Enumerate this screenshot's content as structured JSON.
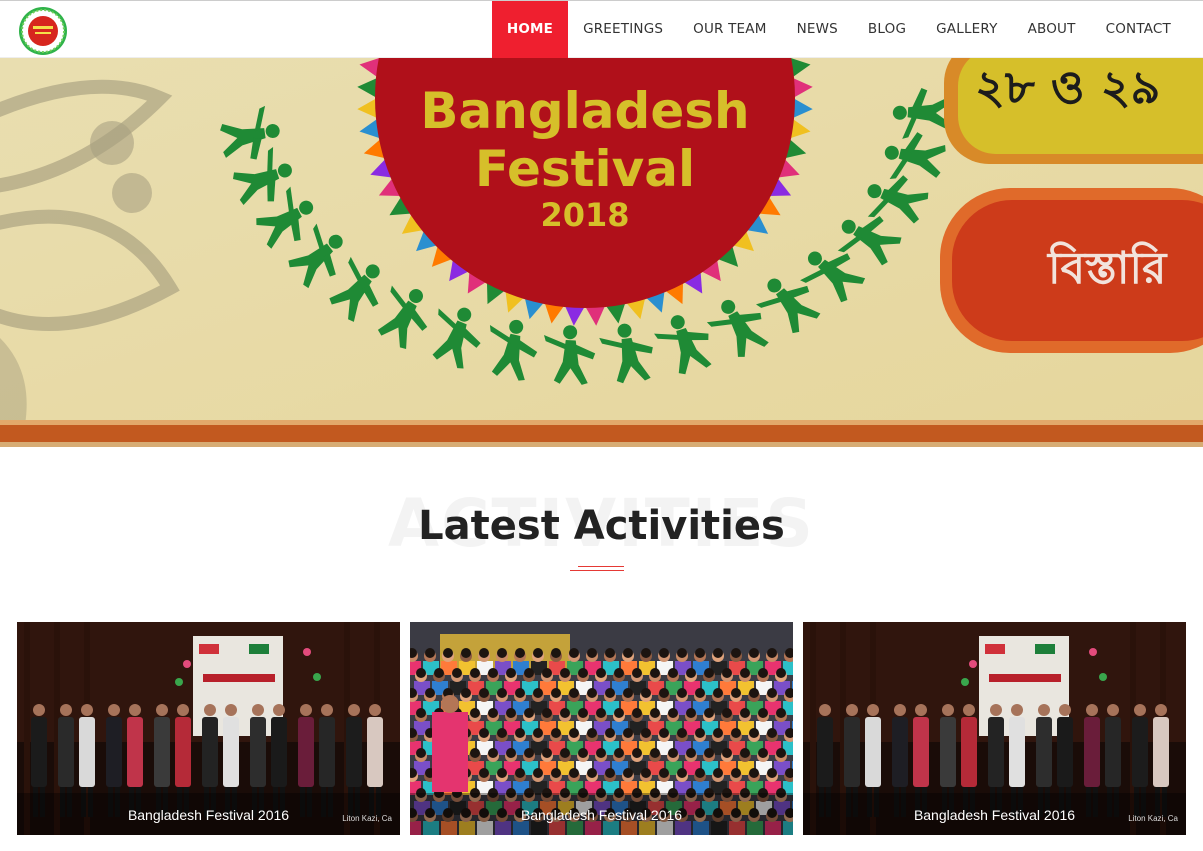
{
  "nav": {
    "items": [
      {
        "label": "HOME",
        "active": true
      },
      {
        "label": "GREETINGS"
      },
      {
        "label": "OUR TEAM"
      },
      {
        "label": "NEWS"
      },
      {
        "label": "BLOG"
      },
      {
        "label": "GALLERY"
      },
      {
        "label": "ABOUT"
      },
      {
        "label": "CONTACT"
      }
    ]
  },
  "hero": {
    "line1": "Bangladesh",
    "line2": "Festival",
    "year": "2018",
    "date_text": "২৮ ও ২৯",
    "detail_text": "বিস্তারি"
  },
  "section": {
    "bg_word": "ACTIVITIES",
    "title": "Latest Activities"
  },
  "cards": [
    {
      "title": "Bangladesh Festival 2016",
      "credit": "Liton Kazi, Ca"
    },
    {
      "title": "Bangladesh Festival 2016",
      "credit": ""
    },
    {
      "title": "Bangladesh Festival 2016",
      "credit": "Liton Kazi, Ca"
    }
  ],
  "colors": {
    "accent": "#ef1f2f",
    "hero_red": "#b0101a",
    "hero_yellow": "#d6bf2a",
    "hero_green": "#1f8a35"
  }
}
